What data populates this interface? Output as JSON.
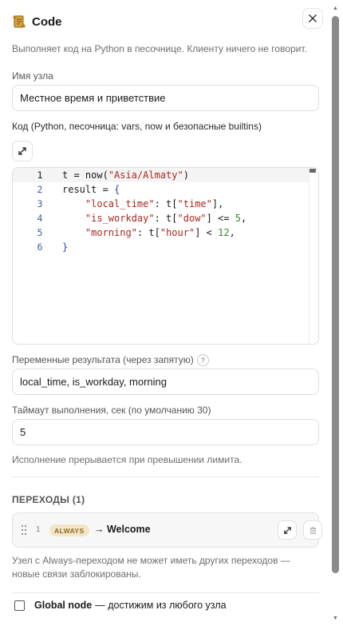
{
  "header": {
    "title": "Code",
    "logo_icon": "scroll-icon"
  },
  "description": "Выполняет код на Python в песочнице. Клиенту ничего не говорит.",
  "node_name": {
    "label": "Имя узла",
    "value": "Местное время и приветствие"
  },
  "code": {
    "label": "Код (Python, песочница: vars, now и безопасные builtins)",
    "lines": [
      {
        "num": "1"
      },
      {
        "num": "2"
      },
      {
        "num": "3"
      },
      {
        "num": "4"
      },
      {
        "num": "5"
      },
      {
        "num": "6"
      }
    ],
    "tokens": {
      "l1_a": "t = now(",
      "l1_b": "\"Asia/Almaty\"",
      "l1_c": ")",
      "l2_a": "result = ",
      "l2_b": "{",
      "l3_a": "    ",
      "l3_b": "\"local_time\"",
      "l3_c": ": t[",
      "l3_d": "\"time\"",
      "l3_e": "],",
      "l4_a": "    ",
      "l4_b": "\"is_workday\"",
      "l4_c": ": t[",
      "l4_d": "\"dow\"",
      "l4_e": "] <= ",
      "l4_f": "5",
      "l4_g": ",",
      "l5_a": "    ",
      "l5_b": "\"morning\"",
      "l5_c": ": t[",
      "l5_d": "\"hour\"",
      "l5_e": "] < ",
      "l5_f": "12",
      "l5_g": ",",
      "l6_a": "}"
    }
  },
  "result_vars": {
    "label": "Переменные результата (через запятую)",
    "help": "?",
    "value": "local_time, is_workday, morning"
  },
  "timeout": {
    "label": "Таймаут выполнения, сек (по умолчанию 30)",
    "value": "5",
    "hint": "Исполнение прерывается при превышении лимита."
  },
  "transitions": {
    "title": "ПЕРЕХОДЫ (1)",
    "items": [
      {
        "index": "1",
        "badge": "ALWAYS",
        "target": "→ Welcome"
      }
    ],
    "hint": "Узел с Always-переходом не может иметь других переходов — новые связи заблокированы."
  },
  "global_node": {
    "strong": "Global node",
    "rest": "— достижим из любого узла",
    "checked": false
  },
  "colors": {
    "badge_bg": "#f3e6c7",
    "badge_text": "#8a6a26",
    "string": "#a8281c",
    "number": "#2e8a2e"
  }
}
